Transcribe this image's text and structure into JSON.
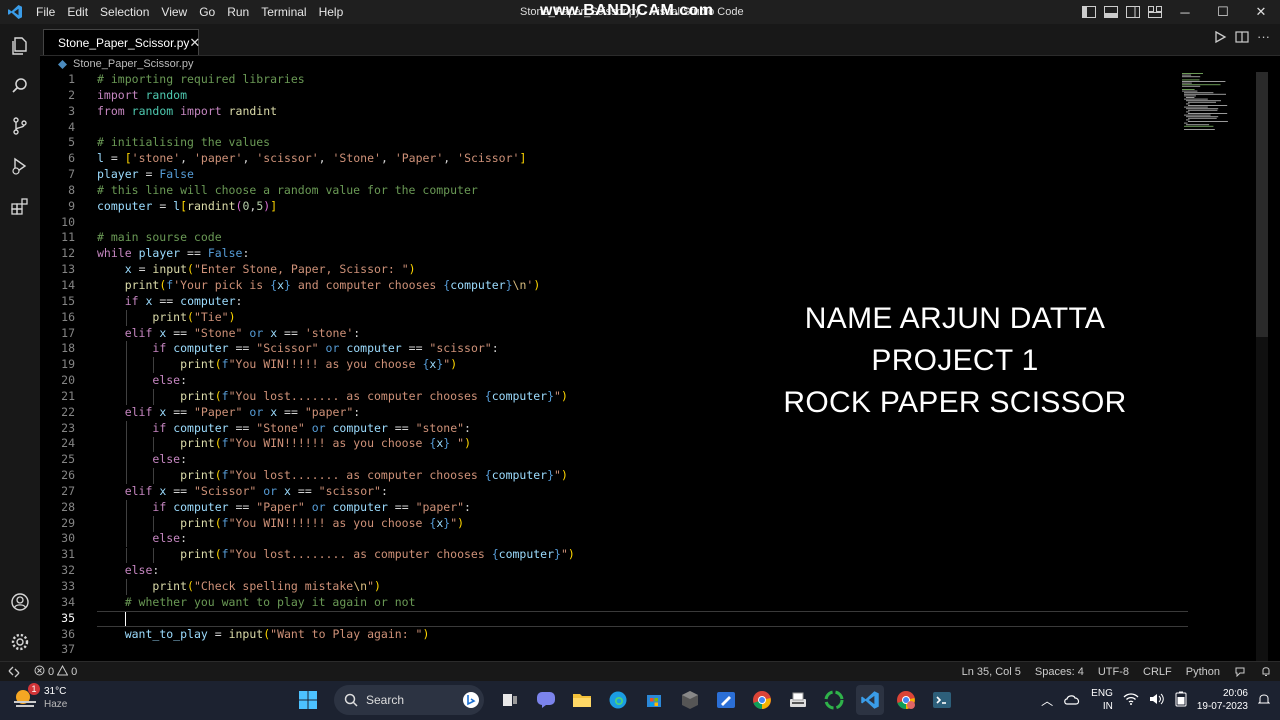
{
  "window": {
    "title": "Stone_Paper_Scissor.py - Visual Studio Code",
    "watermark": "www.BANDICAM.com"
  },
  "menu": [
    "File",
    "Edit",
    "Selection",
    "View",
    "Go",
    "Run",
    "Terminal",
    "Help"
  ],
  "tab": {
    "label": "Stone_Paper_Scissor.py",
    "close": "✕"
  },
  "breadcrumb": "Stone_Paper_Scissor.py",
  "editor": {
    "current_line": 35,
    "lines": [
      "# importing required libraries",
      "import random",
      "from random import randint",
      "",
      "# initialising the values",
      "l = ['stone', 'paper', 'scissor', 'Stone', 'Paper', 'Scissor']",
      "player = False",
      "# this line will choose a random value for the computer",
      "computer = l[randint(0,5)]",
      "",
      "# main sourse code",
      "while player == False:",
      "    x = input(\"Enter Stone, Paper, Scissor: \")",
      "    print(f'Your pick is {x} and computer chooses {computer}\\n')",
      "    if x == computer:",
      "        print(\"Tie\")",
      "    elif x == \"Stone\" or x == 'stone':",
      "        if computer == \"Scissor\" or computer == \"scissor\":",
      "            print(f\"You WIN!!!!! as you choose {x}\")",
      "        else:",
      "            print(f\"You lost....... as computer chooses {computer}\")",
      "    elif x == \"Paper\" or x == \"paper\":",
      "        if computer == \"Stone\" or computer == \"stone\":",
      "            print(f\"You WIN!!!!!! as you choose {x} \")",
      "        else:",
      "            print(f\"You lost....... as computer chooses {computer}\")",
      "    elif x == \"Scissor\" or x == \"scissor\":",
      "        if computer == \"Paper\" or computer == \"paper\":",
      "            print(f\"You WIN!!!!!! as you choose {x}\")",
      "        else:",
      "            print(f\"You lost........ as computer chooses {computer}\")",
      "    else:",
      "        print(\"Check spelling mistake\\n\")",
      "    # whether you want to play it again or not",
      "",
      "    want_to_play = input(\"Want to Play again: \")",
      ""
    ]
  },
  "overlay": {
    "line1": "NAME ARJUN DATTA",
    "line2": "PROJECT 1",
    "line3": "ROCK PAPER SCISSOR"
  },
  "status": {
    "errors": "0",
    "warnings": "0",
    "position": "Ln 35, Col 5",
    "spaces": "Spaces: 4",
    "encoding": "UTF-8",
    "eol": "CRLF",
    "language": "Python"
  },
  "taskbar": {
    "weather_badge": "1",
    "temperature": "31°C",
    "condition": "Haze",
    "search_placeholder": "Search",
    "lang": "ENG",
    "region": "IN",
    "time": "20:06",
    "date": "19-07-2023"
  },
  "colors": {
    "keyword": "#c586c0",
    "blue_keyword": "#569cd6",
    "string": "#ce9178",
    "comment": "#6a9955",
    "variable": "#9cdcfe",
    "function": "#dcdcaa",
    "bracket_gold": "#ffd700",
    "bracket_purple": "#da70d6",
    "number": "#b5cea8",
    "escape": "#d7ba7d",
    "accent": "#0078d4"
  }
}
